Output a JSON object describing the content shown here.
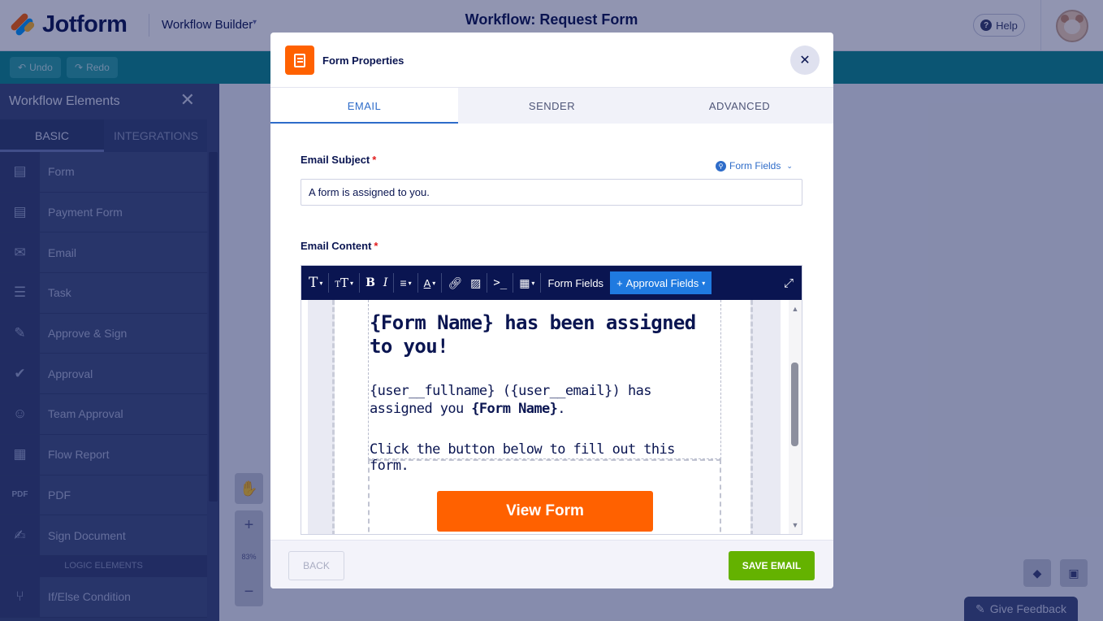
{
  "app": {
    "logo_text": "Jotform",
    "builder_label": "Workflow Builder",
    "workflow_title": "Workflow: Request Form",
    "help_label": "Help",
    "undo_label": "Undo",
    "redo_label": "Redo"
  },
  "sidebar": {
    "title": "Workflow Elements",
    "tabs": [
      {
        "label": "BASIC"
      },
      {
        "label": "INTEGRATIONS"
      }
    ],
    "items": [
      {
        "label": "Form",
        "icon": "form-icon"
      },
      {
        "label": "Payment Form",
        "icon": "payment-form-icon"
      },
      {
        "label": "Email",
        "icon": "email-icon"
      },
      {
        "label": "Task",
        "icon": "task-icon"
      },
      {
        "label": "Approve & Sign",
        "icon": "approve-sign-icon"
      },
      {
        "label": "Approval",
        "icon": "approval-icon"
      },
      {
        "label": "Team Approval",
        "icon": "team-approval-icon"
      },
      {
        "label": "Flow Report",
        "icon": "flow-report-icon"
      },
      {
        "label": "PDF",
        "icon": "pdf-icon"
      },
      {
        "label": "Sign Document",
        "icon": "sign-document-icon"
      }
    ],
    "logic_header": "LOGIC ELEMENTS",
    "logic_items": [
      {
        "label": "If/Else Condition",
        "icon": "condition-icon"
      }
    ]
  },
  "canvas": {
    "zoom_level": "83%",
    "feedback_label": "Give Feedback"
  },
  "modal": {
    "title": "Form Properties",
    "tabs": [
      {
        "label": "EMAIL",
        "active": true
      },
      {
        "label": "SENDER",
        "active": false
      },
      {
        "label": "ADVANCED",
        "active": false
      }
    ],
    "subject_label": "Email Subject",
    "required_mark": "*",
    "form_fields_link": "Form Fields",
    "subject_value": "A form is assigned to you.",
    "content_label": "Email Content",
    "editor": {
      "toolbar_form_fields": "Form Fields",
      "toolbar_approval_fields": "Approval Fields",
      "heading": "{Form Name} has been assigned to you!",
      "para_prefix": "{user__fullname} ({user__email}) has assigned you ",
      "para_bold": "{Form Name}",
      "para_suffix": ".",
      "para2": "Click the button below to fill out this form.",
      "button_label": "View Form"
    },
    "back_label": "BACK",
    "save_label": "SAVE EMAIL"
  },
  "colors": {
    "accent": "#2e6cc9",
    "brand_orange": "#ff6100",
    "save_green": "#64b200",
    "navy": "#0a1551"
  }
}
